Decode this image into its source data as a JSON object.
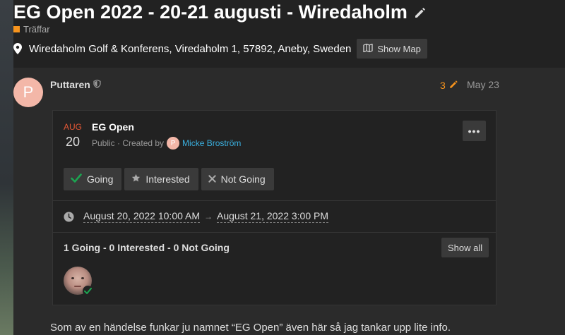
{
  "topic": {
    "title": "EG Open 2022 - 20-21 augusti - Wiredaholm",
    "category": "Träffar",
    "location": "Wiredaholm Golf & Konferens, Viredaholm 1, 57892, Aneby, Sweden",
    "show_map_label": "Show Map"
  },
  "post": {
    "avatar_letter": "P",
    "username": "Puttaren",
    "edit_count": "3",
    "date": "May 23",
    "body_text": "Som av en händelse funkar ju namnet “EG Open” även här så jag tankar upp lite info."
  },
  "event": {
    "month": "AUG",
    "day": "20",
    "name": "EG Open",
    "meta_prefix": "Public · Created by",
    "creator_avatar_letter": "P",
    "creator_name": "Micke Broström",
    "more_label": "•••",
    "rsvp": {
      "going": "Going",
      "interested": "Interested",
      "not_going": "Not Going"
    },
    "start": "August 20, 2022 10:00 AM",
    "arrow": "→",
    "end": "August 21, 2022 3:00 PM",
    "summary": "1 Going - 0 Interested - 0 Not Going",
    "show_all_label": "Show all"
  },
  "colors": {
    "accent_orange": "#f7941d",
    "month_red": "#e45735",
    "link_blue": "#3ab0e0",
    "going_green": "#1ca551"
  },
  "icons": [
    "pencil-icon",
    "map-pin-icon",
    "map-icon",
    "shield-icon",
    "check-icon",
    "star-icon",
    "times-icon",
    "clock-icon"
  ]
}
